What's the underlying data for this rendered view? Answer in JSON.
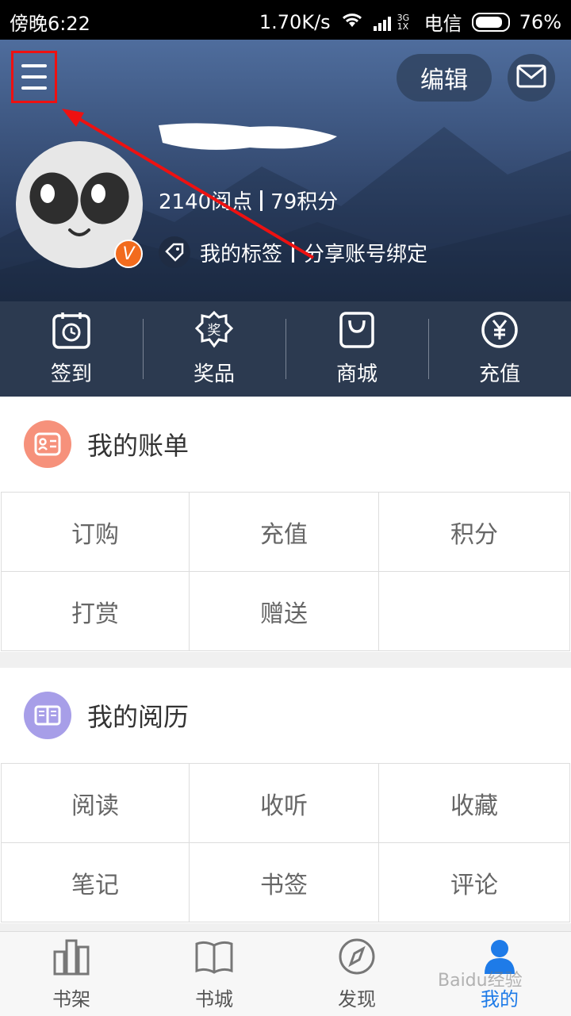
{
  "status_bar": {
    "time": "傍晚6:22",
    "speed": "1.70K/s",
    "network": "3G 1X",
    "carrier": "电信",
    "battery": "76%"
  },
  "header": {
    "edit_label": "编辑",
    "stats_points": "2140阅点",
    "stats_credits": "79积分",
    "v_badge": "V",
    "tag_label": "我的标签",
    "share_label": "分享账号绑定"
  },
  "quick_actions": [
    {
      "label": "签到",
      "icon": "calendar-icon"
    },
    {
      "label": "奖品",
      "icon": "prize-icon"
    },
    {
      "label": "商城",
      "icon": "shopping-bag-icon"
    },
    {
      "label": "充值",
      "icon": "yuan-icon"
    }
  ],
  "bill": {
    "title": "我的账单",
    "icon_color": "#f6917b",
    "items": [
      "订购",
      "充值",
      "积分",
      "打赏",
      "赠送",
      ""
    ]
  },
  "reading": {
    "title": "我的阅历",
    "icon_color": "#a79ee8",
    "items": [
      "阅读",
      "收听",
      "收藏",
      "笔记",
      "书签",
      "评论"
    ]
  },
  "tabs": [
    {
      "label": "书架",
      "icon": "bookshelf-icon",
      "active": false
    },
    {
      "label": "书城",
      "icon": "book-icon",
      "active": false
    },
    {
      "label": "发现",
      "icon": "compass-icon",
      "active": false
    },
    {
      "label": "我的",
      "icon": "profile-icon",
      "active": true
    }
  ],
  "watermark": "Baidu经验"
}
